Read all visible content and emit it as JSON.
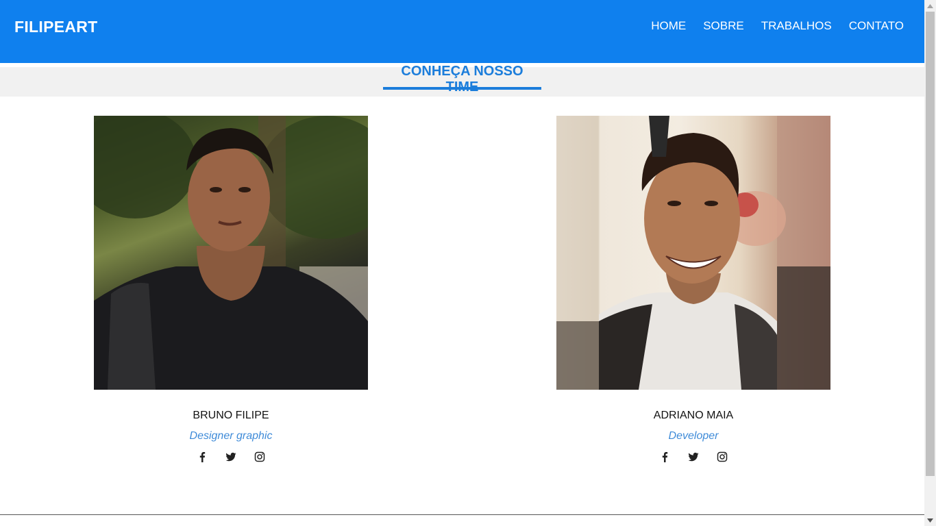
{
  "header": {
    "brand": "FILIPEART",
    "nav": [
      "HOME",
      "SOBRE",
      "TRABALHOS",
      "CONTATO"
    ]
  },
  "section": {
    "title": "CONHEÇA NOSSO TIME"
  },
  "team": [
    {
      "name": "BRUNO FILIPE",
      "role": "Designer graphic",
      "photo_icon": "portrait-photo"
    },
    {
      "name": "ADRIANO MAIA",
      "role": "Developer",
      "photo_icon": "portrait-photo"
    }
  ],
  "social_icons": [
    "facebook-icon",
    "twitter-icon",
    "instagram-icon"
  ],
  "colors": {
    "header": "#0f80ee",
    "accent": "#1b7ddb",
    "role": "#3f8bd8",
    "band": "#f1f1f1"
  }
}
